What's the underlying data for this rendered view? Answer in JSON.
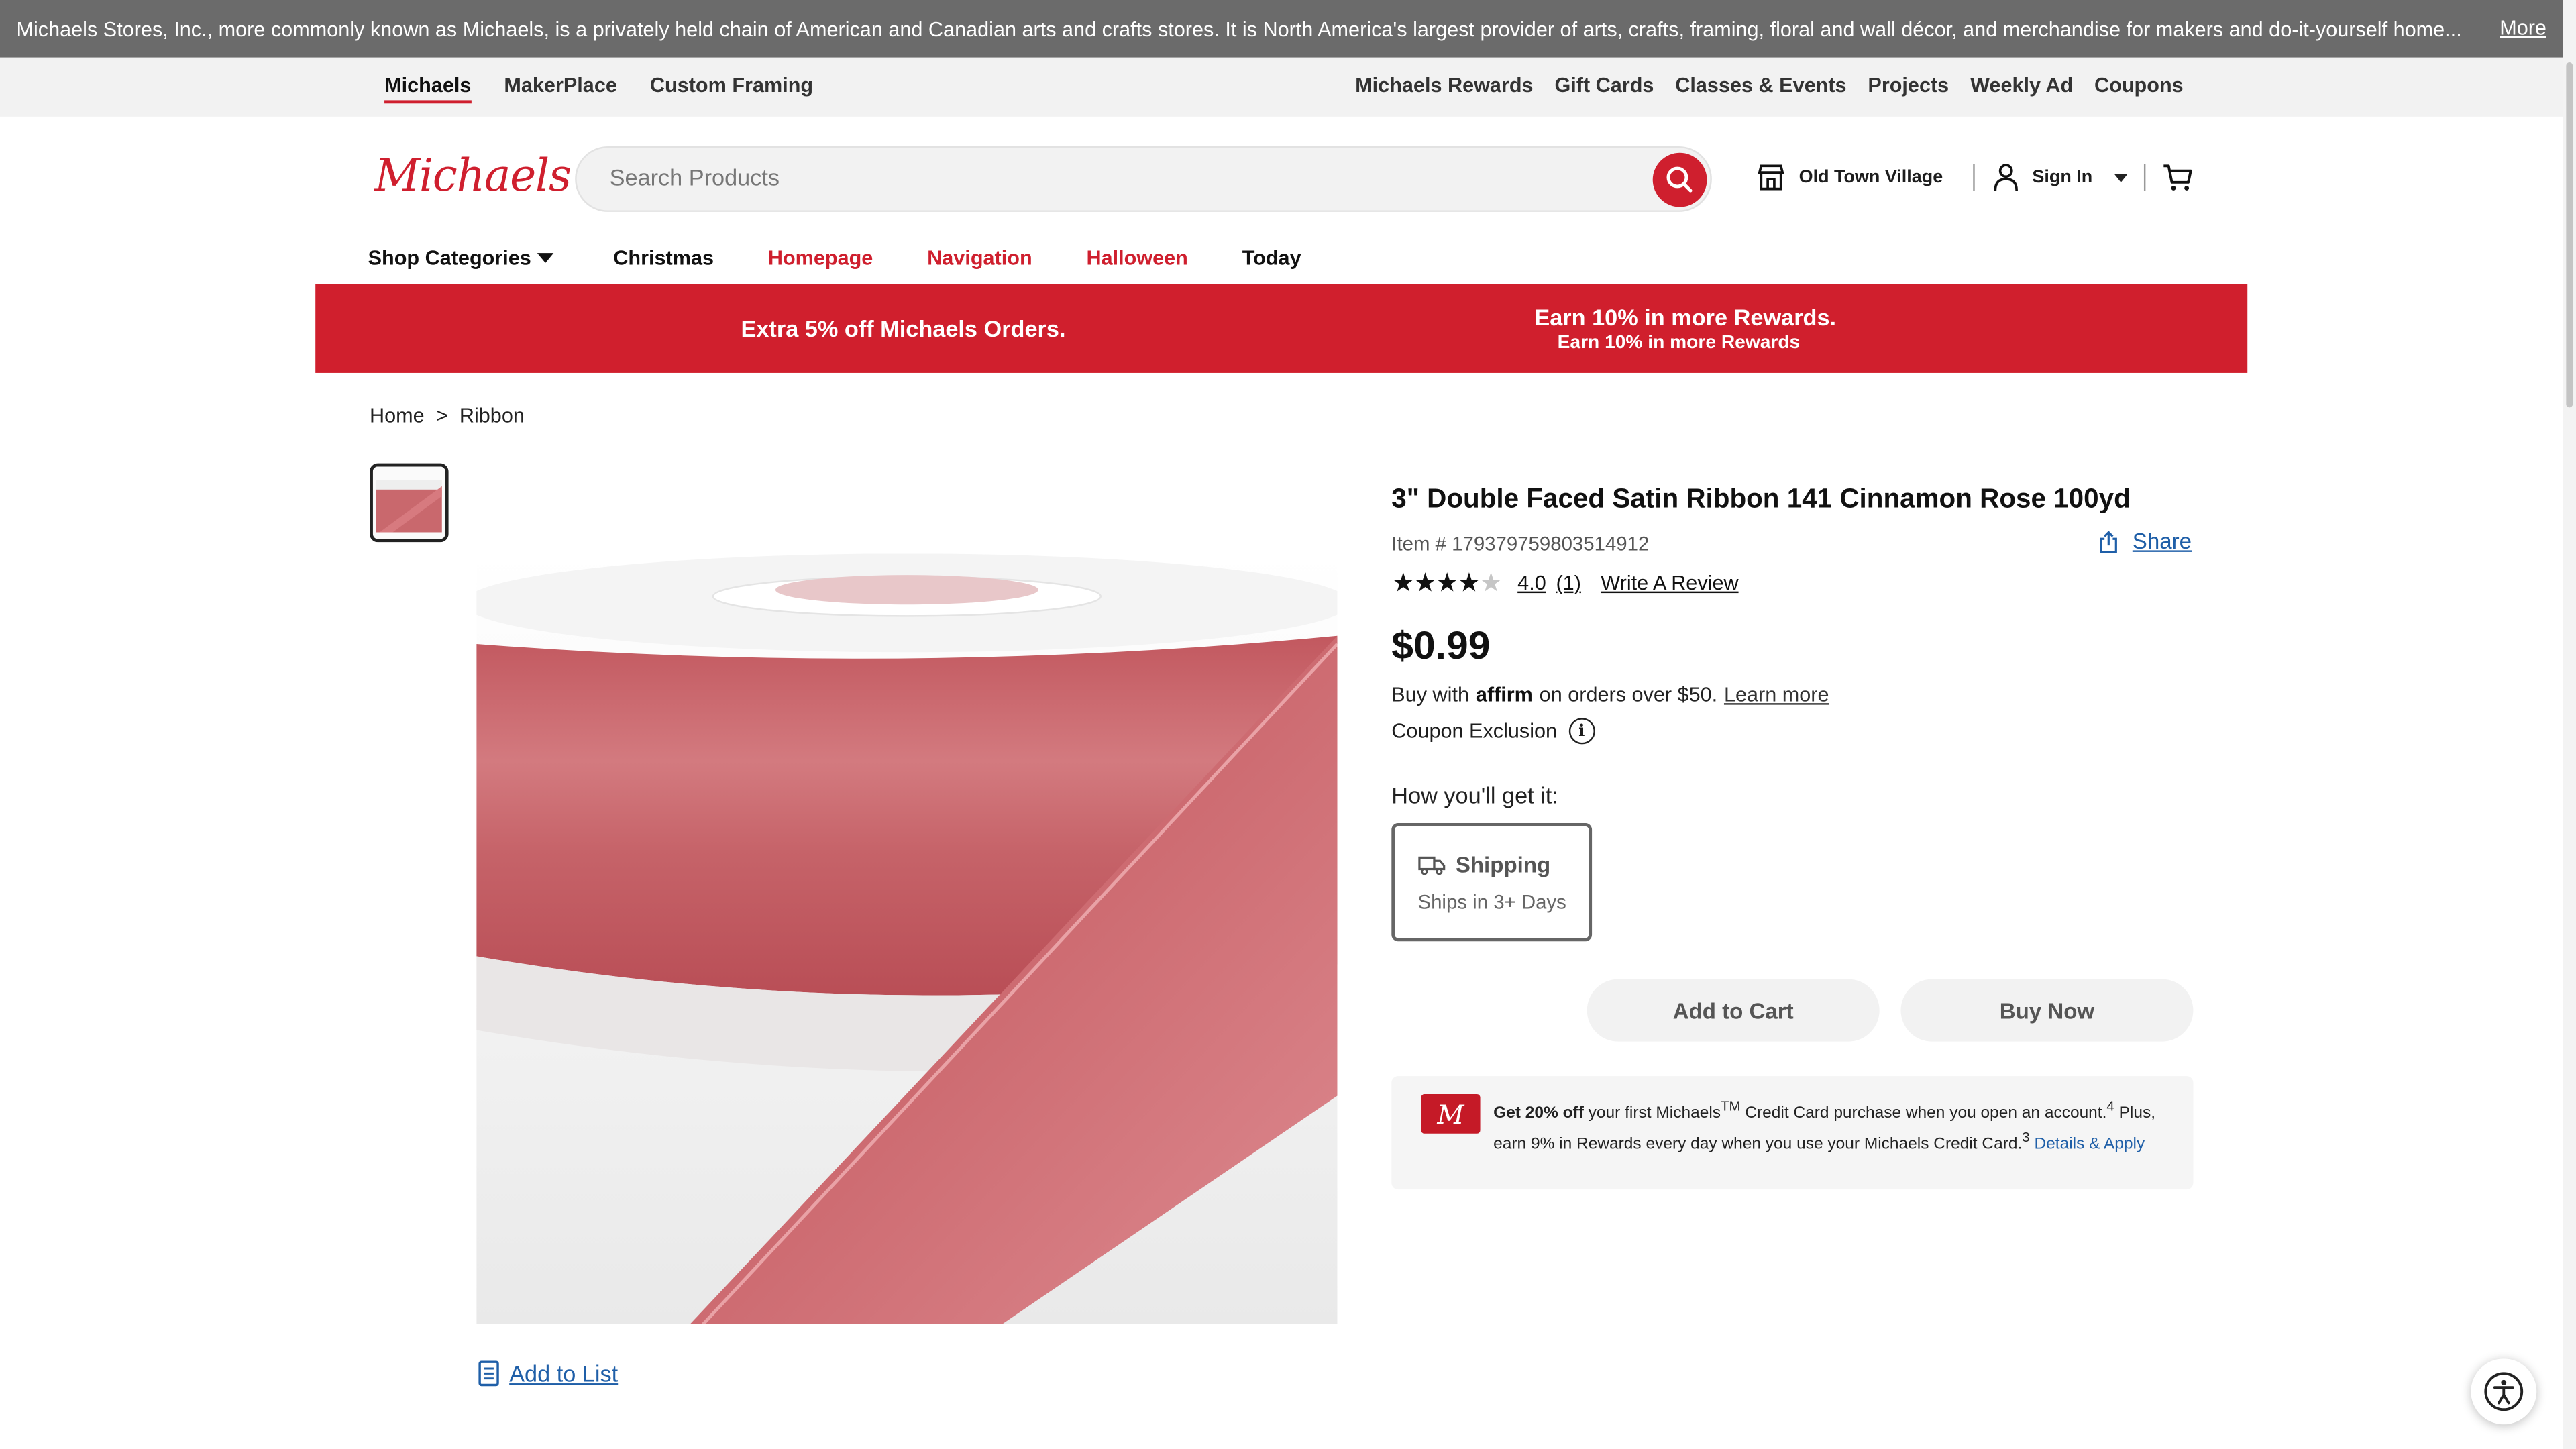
{
  "topbar": {
    "description": "Michaels Stores, Inc., more commonly known as Michaels, is a privately held chain of American and Canadian arts and crafts stores. It is North America's largest provider of arts, crafts, framing, floral and wall décor, and merchandise for makers and do-it-yourself home...",
    "more_label": "More"
  },
  "subnav": {
    "left": [
      "Michaels",
      "MakerPlace",
      "Custom Framing"
    ],
    "right": [
      "Michaels Rewards",
      "Gift Cards",
      "Classes & Events",
      "Projects",
      "Weekly Ad",
      "Coupons"
    ]
  },
  "header": {
    "logo_text": "Michaels",
    "search_placeholder": "Search Products",
    "store_label": "Old Town Village",
    "signin_label": "Sign In"
  },
  "catnav": {
    "shop_categories": "Shop Categories",
    "links": [
      "Christmas",
      "Homepage",
      "Navigation",
      "Halloween",
      "Today"
    ]
  },
  "promo": {
    "left": "Extra 5% off Michaels Orders.",
    "right_title": "Earn 10% in more Rewards.",
    "right_sub": "Earn 10% in more Rewards"
  },
  "breadcrumb": [
    "Home",
    ">",
    "Ribbon"
  ],
  "product": {
    "title": "3\" Double Faced Satin Ribbon 141 Cinnamon Rose 100yd",
    "item_number": "Item # 179379759803514912",
    "share_label": "Share",
    "rating_value": "4.0",
    "rating_count": "(1)",
    "rating_stars": 4,
    "write_review": "Write A Review",
    "price": "$0.99",
    "affirm_prefix": "Buy with",
    "affirm_brand": "affirm",
    "affirm_suffix": "on orders over $50.",
    "affirm_link": "Learn more",
    "coupon_exclusion": "Coupon Exclusion",
    "how_get": "How you'll get it:",
    "shipping_title": "Shipping",
    "shipping_sub": "Ships in 3+ Days",
    "add_to_cart": "Add to Cart",
    "buy_now": "Buy Now",
    "add_to_list": "Add to List"
  },
  "credit_card": {
    "bold": "Get 20% off",
    "text1": "your first Michaels",
    "tm": "TM",
    "text2": "Credit Card purchase when you open an account.",
    "sup1": "4",
    "text3": "Plus, earn 9% in Rewards every day when you use your Michaels Credit Card.",
    "sup2": "3",
    "link": "Details & Apply"
  },
  "colors": {
    "brand_red": "#d01f2d",
    "link_blue": "#1f5fa8",
    "ribbon": "#c9686d"
  }
}
